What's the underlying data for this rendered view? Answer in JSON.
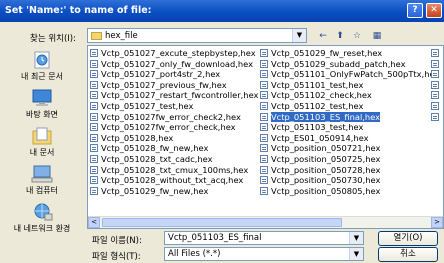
{
  "titlebar": {
    "title": "Set 'Name:' to name of file:",
    "help": "?",
    "close": "✕"
  },
  "lookin": {
    "label": "찾는 위치(I):",
    "value": "hex_file"
  },
  "toolbar": {
    "back": "←",
    "up": "⬆",
    "newfolder": "☆",
    "view": "▦"
  },
  "places": [
    {
      "label": "내 최근 문서"
    },
    {
      "label": "바탕 화면"
    },
    {
      "label": "내 문서"
    },
    {
      "label": "내 컴퓨터"
    },
    {
      "label": "내 네트워크 환경"
    }
  ],
  "files": {
    "col1": [
      "Vctp_051027_excute_stepbystep,hex",
      "Vctp_051027_only_fw_download,hex",
      "Vctp_051027_port4str_2,hex",
      "Vctp_051027_previous_fw,hex",
      "Vctp_051027_restart_fwcontroller,hex",
      "Vctp_051027_test,hex",
      "Vctp_051027fw_error_check2,hex",
      "Vctp_051027fw_error_check,hex",
      "Vctp_051028,hex",
      "Vctp_051028_fw_new,hex",
      "Vctp_051028_txt_cadc,hex",
      "Vctp_051028_txt_cmux_100ms,hex",
      "Vctp_051028_without_txt_acq,hex",
      "Vctp_051029_fw_new,hex"
    ],
    "col2": [
      "Vctp_051029_fw_reset,hex",
      "Vctp_051029_subadd_patch,hex",
      "Vctp_051101_OnlyFwPatch_500pTtx,hex",
      "Vctp_051101_test,hex",
      "Vctp_051102_check,hex",
      "Vctp_051102_test,hex",
      "Vctp_051103_ES_final,hex",
      "Vctp_051103_test,hex",
      "Vctp_ES01_050914,hex",
      "Vctp_position_050721,hex",
      "Vctp_position_050725,hex",
      "Vctp_position_050728,hex",
      "Vctp_position_050730,hex",
      "Vctp_position_050805,hex"
    ],
    "selected_index": 6
  },
  "filename": {
    "label": "파일 이름(N):",
    "value": "Vctp_051103_ES_final"
  },
  "filetype": {
    "label": "파일 형식(T):",
    "value": "All Files (*.*)"
  },
  "buttons": {
    "open": "열기(O)",
    "cancel": "취소"
  },
  "scroll": {
    "left": "<",
    "right": ">"
  },
  "colors": {
    "titlebar": "#0a4ec2",
    "selection": "#316ac5",
    "dialog": "#ece9d8"
  }
}
